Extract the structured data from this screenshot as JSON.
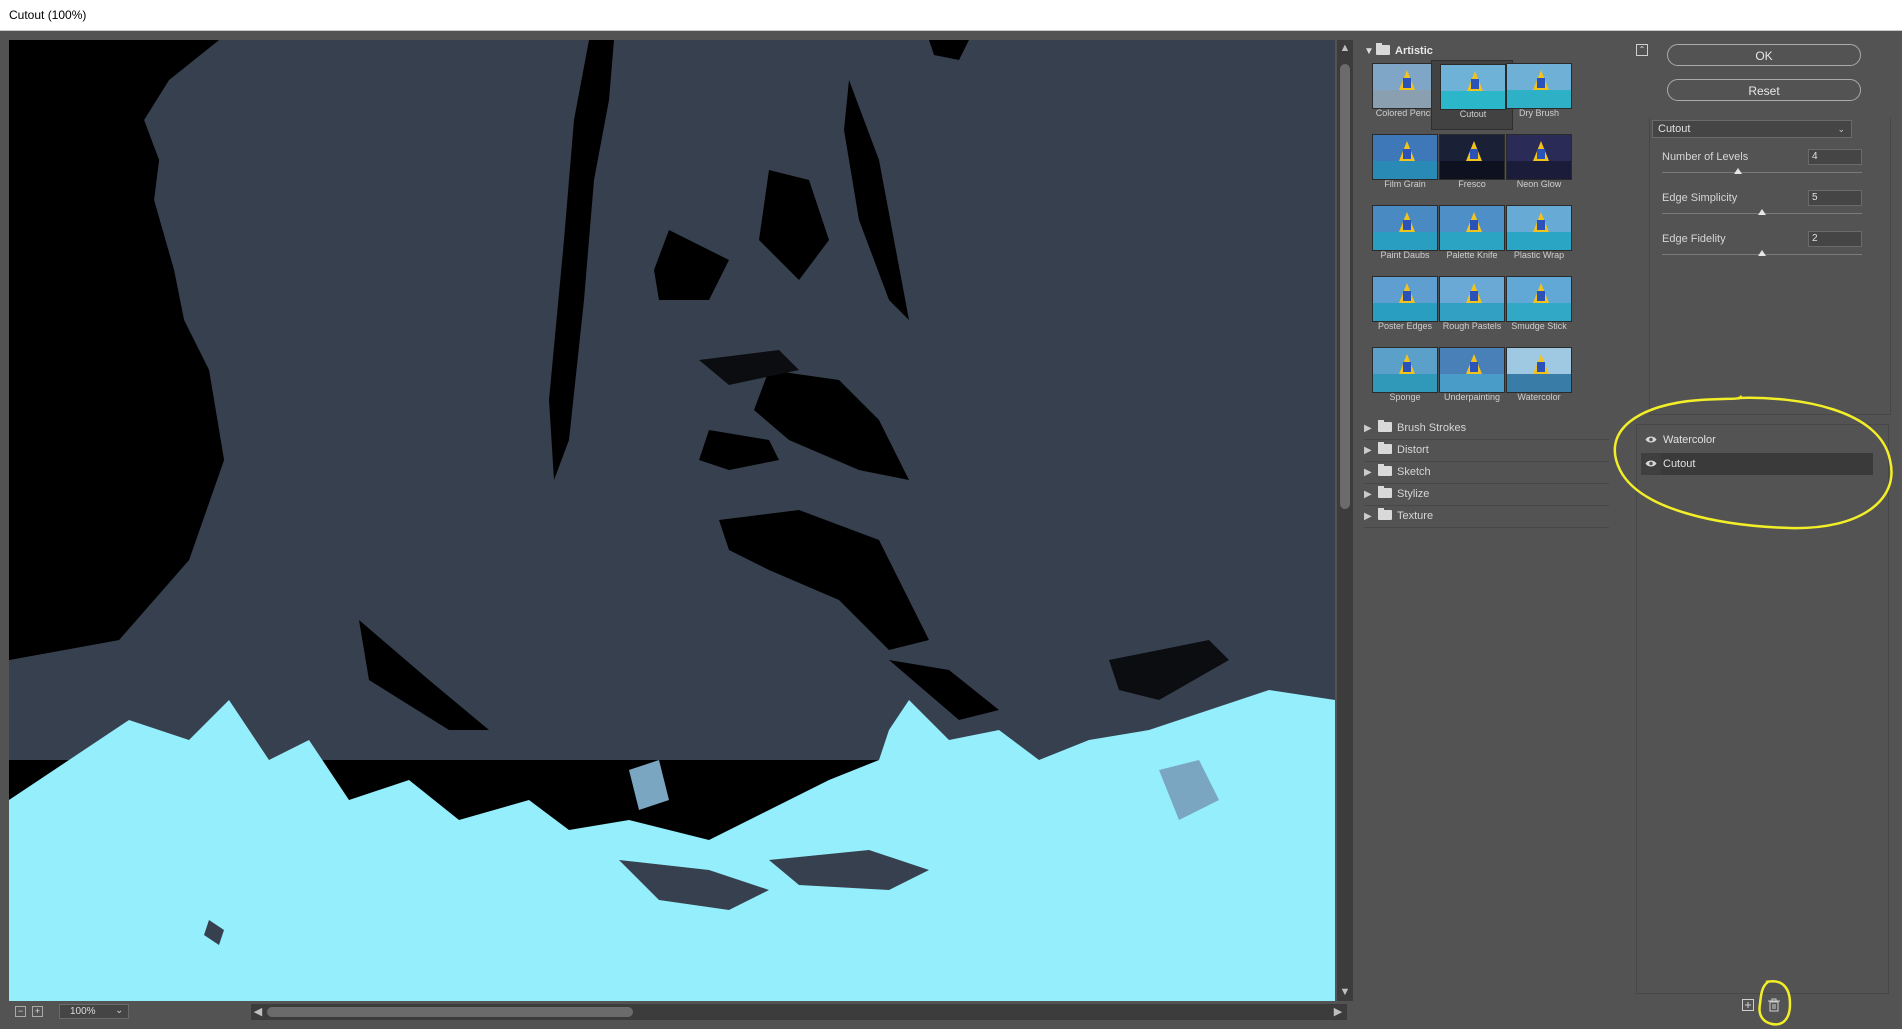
{
  "window": {
    "title": "Cutout (100%)"
  },
  "preview": {
    "zoom": "100%"
  },
  "gallery": {
    "category_open": "Artistic",
    "thumbnails": [
      {
        "label": "Colored Pencil"
      },
      {
        "label": "Cutout"
      },
      {
        "label": "Dry Brush"
      },
      {
        "label": "Film Grain"
      },
      {
        "label": "Fresco"
      },
      {
        "label": "Neon Glow"
      },
      {
        "label": "Paint Daubs"
      },
      {
        "label": "Palette Knife"
      },
      {
        "label": "Plastic Wrap"
      },
      {
        "label": "Poster Edges"
      },
      {
        "label": "Rough Pastels"
      },
      {
        "label": "Smudge Stick"
      },
      {
        "label": "Sponge"
      },
      {
        "label": "Underpainting"
      },
      {
        "label": "Watercolor"
      }
    ],
    "selected": "Cutout",
    "categories": [
      "Brush Strokes",
      "Distort",
      "Sketch",
      "Stylize",
      "Texture"
    ]
  },
  "buttons": {
    "ok": "OK",
    "reset": "Reset"
  },
  "filter_select": {
    "value": "Cutout"
  },
  "params": [
    {
      "label": "Number of Levels",
      "value": "4",
      "level": 0.38
    },
    {
      "label": "Edge Simplicity",
      "value": "5",
      "level": 0.5
    },
    {
      "label": "Edge Fidelity",
      "value": "2",
      "level": 0.5
    }
  ],
  "layers": [
    {
      "name": "Watercolor",
      "selected": false
    },
    {
      "name": "Cutout",
      "selected": true
    }
  ],
  "colors": {
    "panel": "#535353",
    "annotation": "#f2ee28",
    "water": "#94eefb",
    "shadow_blue": "#36404e"
  }
}
